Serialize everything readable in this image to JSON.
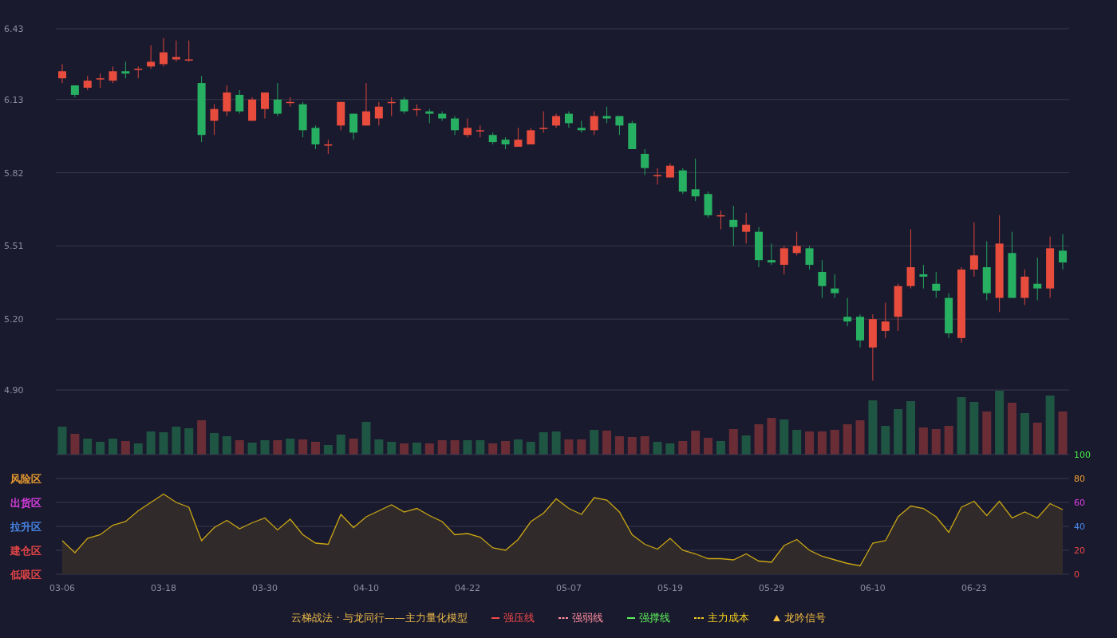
{
  "price_chart": {
    "chart_data": {
      "type": "candlestick",
      "grid": true,
      "ylim": [
        4.9,
        6.43
      ],
      "yticks": [
        {
          "value": 6.43,
          "label": "6.43"
        },
        {
          "value": 6.13,
          "label": "6.13"
        },
        {
          "value": 5.82,
          "label": "5.82"
        },
        {
          "value": 5.51,
          "label": "5.51"
        },
        {
          "value": 5.2,
          "label": "5.20"
        },
        {
          "value": 4.9,
          "label": "4.90"
        }
      ],
      "categories": [
        null,
        null,
        null,
        null,
        null,
        null,
        null,
        null,
        null,
        null,
        null,
        null,
        null,
        null,
        null,
        null,
        null,
        null,
        null,
        null,
        null,
        null,
        null,
        null,
        null,
        null,
        null,
        null,
        null,
        null,
        null,
        null,
        null,
        null,
        null,
        null,
        null,
        null,
        null,
        null,
        null,
        null,
        null,
        null,
        null,
        null,
        null,
        null,
        null,
        null,
        null,
        null,
        null,
        null,
        null,
        null,
        null,
        null,
        null,
        null,
        null,
        null,
        null,
        null,
        null,
        null,
        null,
        null,
        null,
        null,
        null,
        null,
        null,
        null,
        null,
        null,
        null,
        null,
        null,
        null
      ],
      "ohlc": [
        [
          6.22,
          6.28,
          6.2,
          6.25
        ],
        [
          6.19,
          6.19,
          6.14,
          6.15
        ],
        [
          6.18,
          6.23,
          6.17,
          6.21
        ],
        [
          6.22,
          6.24,
          6.18,
          6.22
        ],
        [
          6.21,
          6.27,
          6.2,
          6.25
        ],
        [
          6.25,
          6.29,
          6.22,
          6.24
        ],
        [
          6.26,
          6.27,
          6.22,
          6.26
        ],
        [
          6.27,
          6.36,
          6.26,
          6.29
        ],
        [
          6.28,
          6.39,
          6.27,
          6.33
        ],
        [
          6.3,
          6.38,
          6.29,
          6.31
        ],
        [
          6.3,
          6.38,
          6.29,
          6.3
        ],
        [
          6.2,
          6.23,
          5.95,
          5.98
        ],
        [
          6.04,
          6.11,
          5.98,
          6.09
        ],
        [
          6.08,
          6.19,
          6.06,
          6.16
        ],
        [
          6.15,
          6.17,
          6.07,
          6.08
        ],
        [
          6.04,
          6.14,
          6.04,
          6.13
        ],
        [
          6.09,
          6.16,
          6.05,
          6.16
        ],
        [
          6.13,
          6.2,
          6.06,
          6.07
        ],
        [
          6.12,
          6.14,
          6.1,
          6.12
        ],
        [
          6.11,
          6.12,
          5.97,
          6.0
        ],
        [
          6.01,
          6.02,
          5.92,
          5.94
        ],
        [
          5.94,
          5.96,
          5.9,
          5.94
        ],
        [
          6.02,
          6.12,
          6.0,
          6.12
        ],
        [
          6.07,
          6.07,
          5.96,
          5.99
        ],
        [
          6.02,
          6.2,
          6.02,
          6.08
        ],
        [
          6.05,
          6.12,
          6.02,
          6.1
        ],
        [
          6.12,
          6.14,
          6.06,
          6.12
        ],
        [
          6.13,
          6.14,
          6.07,
          6.08
        ],
        [
          6.09,
          6.11,
          6.06,
          6.09
        ],
        [
          6.08,
          6.09,
          6.03,
          6.07
        ],
        [
          6.07,
          6.08,
          6.04,
          6.05
        ],
        [
          6.05,
          6.06,
          5.98,
          6.0
        ],
        [
          5.98,
          6.05,
          5.97,
          6.01
        ],
        [
          6.0,
          6.02,
          5.97,
          6.0
        ],
        [
          5.98,
          5.99,
          5.94,
          5.95
        ],
        [
          5.96,
          5.97,
          5.92,
          5.94
        ],
        [
          5.93,
          6.01,
          5.93,
          5.96
        ],
        [
          5.94,
          6.01,
          5.94,
          6.0
        ],
        [
          6.01,
          6.08,
          5.99,
          6.01
        ],
        [
          6.02,
          6.07,
          6.01,
          6.06
        ],
        [
          6.07,
          6.08,
          6.01,
          6.03
        ],
        [
          6.01,
          6.04,
          5.99,
          6.0
        ],
        [
          6.0,
          6.08,
          5.98,
          6.06
        ],
        [
          6.06,
          6.1,
          6.03,
          6.05
        ],
        [
          6.06,
          6.06,
          5.98,
          6.02
        ],
        [
          6.03,
          6.04,
          5.92,
          5.92
        ],
        [
          5.9,
          5.92,
          5.81,
          5.84
        ],
        [
          5.81,
          5.84,
          5.77,
          5.81
        ],
        [
          5.8,
          5.86,
          5.8,
          5.85
        ],
        [
          5.83,
          5.84,
          5.73,
          5.74
        ],
        [
          5.75,
          5.88,
          5.7,
          5.72
        ],
        [
          5.73,
          5.74,
          5.63,
          5.64
        ],
        [
          5.64,
          5.66,
          5.58,
          5.64
        ],
        [
          5.62,
          5.68,
          5.51,
          5.59
        ],
        [
          5.57,
          5.65,
          5.52,
          5.6
        ],
        [
          5.57,
          5.59,
          5.42,
          5.45
        ],
        [
          5.45,
          5.52,
          5.43,
          5.44
        ],
        [
          5.43,
          5.51,
          5.39,
          5.5
        ],
        [
          5.48,
          5.57,
          5.47,
          5.51
        ],
        [
          5.5,
          5.51,
          5.41,
          5.43
        ],
        [
          5.4,
          5.45,
          5.29,
          5.34
        ],
        [
          5.33,
          5.39,
          5.29,
          5.31
        ],
        [
          5.21,
          5.29,
          5.17,
          5.19
        ],
        [
          5.21,
          5.22,
          5.08,
          5.11
        ],
        [
          5.08,
          5.22,
          4.94,
          5.2
        ],
        [
          5.15,
          5.27,
          5.12,
          5.19
        ],
        [
          5.21,
          5.35,
          5.15,
          5.34
        ],
        [
          5.34,
          5.58,
          5.33,
          5.42
        ],
        [
          5.39,
          5.43,
          5.33,
          5.38
        ],
        [
          5.35,
          5.4,
          5.29,
          5.32
        ],
        [
          5.29,
          5.31,
          5.12,
          5.14
        ],
        [
          5.12,
          5.42,
          5.1,
          5.41
        ],
        [
          5.41,
          5.61,
          5.38,
          5.47
        ],
        [
          5.42,
          5.53,
          5.28,
          5.31
        ],
        [
          5.29,
          5.64,
          5.23,
          5.52
        ],
        [
          5.48,
          5.57,
          5.29,
          5.29
        ],
        [
          5.29,
          5.41,
          5.26,
          5.38
        ],
        [
          5.35,
          5.46,
          5.28,
          5.33
        ],
        [
          5.33,
          5.55,
          5.29,
          5.5
        ],
        [
          5.49,
          5.56,
          5.41,
          5.44
        ]
      ]
    }
  },
  "indicator": {
    "zones": [
      {
        "label": "风险区",
        "color": "#f0a030"
      },
      {
        "label": "出货区",
        "color": "#e040e8"
      },
      {
        "label": "拉升区",
        "color": "#4a8cf0"
      },
      {
        "label": "建仓区",
        "color": "#f04848"
      },
      {
        "label": "低吸区",
        "color": "#f04848"
      }
    ],
    "tick_colors": [
      {
        "color": "#44ee44"
      },
      {
        "color": "#f0a030"
      },
      {
        "color": "#e040e8"
      },
      {
        "color": "#4a8cf0"
      },
      {
        "color": "#f04848"
      },
      {
        "color": "#f04848"
      }
    ],
    "chart_data": {
      "type": "area",
      "grid": true,
      "ylim": [
        0,
        100
      ],
      "yticks": [
        100,
        80,
        60,
        40,
        20,
        0
      ],
      "categories": [
        "03-06",
        null,
        null,
        null,
        null,
        null,
        null,
        null,
        "03-18",
        null,
        null,
        null,
        null,
        null,
        null,
        null,
        "03-30",
        null,
        null,
        null,
        null,
        null,
        null,
        null,
        "04-10",
        null,
        null,
        null,
        null,
        null,
        null,
        null,
        "04-22",
        null,
        null,
        null,
        null,
        null,
        null,
        null,
        "05-07",
        null,
        null,
        null,
        null,
        null,
        null,
        null,
        "05-19",
        null,
        null,
        null,
        null,
        null,
        null,
        null,
        "05-29",
        null,
        null,
        null,
        null,
        null,
        null,
        null,
        "06-10",
        null,
        null,
        null,
        null,
        null,
        null,
        null,
        "06-23",
        null,
        null,
        null,
        null,
        null,
        null,
        null
      ],
      "series": [
        {
          "color": "#c9a514",
          "values": [
            28,
            18,
            30,
            33,
            41,
            44,
            53,
            60,
            67,
            60,
            56,
            28,
            39,
            45,
            38,
            43,
            47,
            37,
            46,
            33,
            26,
            25,
            50,
            39,
            48,
            53,
            58,
            52,
            55,
            49,
            44,
            33,
            34,
            31,
            22,
            20,
            29,
            44,
            51,
            63,
            55,
            50,
            64,
            62,
            52,
            33,
            25,
            21,
            30,
            20,
            17,
            13,
            13,
            12,
            17,
            11,
            10,
            24,
            29,
            20,
            15,
            12,
            9,
            7,
            26,
            28,
            48,
            57,
            55,
            48,
            35,
            56,
            61,
            49,
            61,
            47,
            52,
            47,
            59,
            54
          ]
        }
      ]
    }
  },
  "legend": {
    "title": "云梯战法 · 与龙同行——主力量化模型",
    "items": [
      {
        "kind": "solid",
        "label": "强压线",
        "color": "#f04a4a"
      },
      {
        "kind": "dashed",
        "label": "强弱线",
        "color": "#ff8f9f"
      },
      {
        "kind": "solid",
        "label": "强撑线",
        "color": "#5cf05c"
      },
      {
        "kind": "dashed",
        "label": "主力成本",
        "color": "#f5d020"
      },
      {
        "kind": "triangle",
        "label": "龙吟信号",
        "color": "#f5c040"
      }
    ]
  }
}
